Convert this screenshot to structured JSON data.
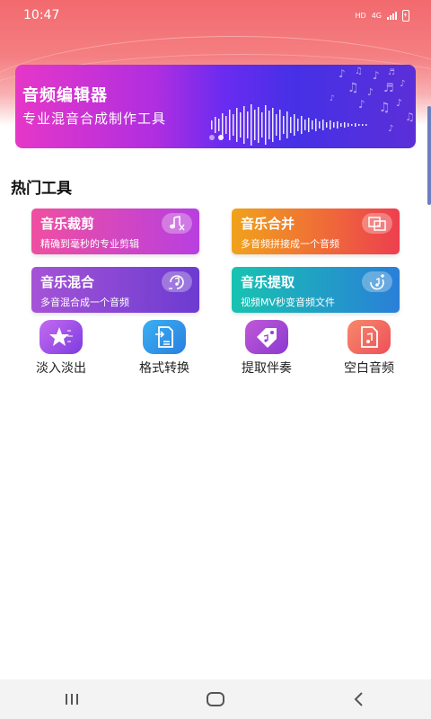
{
  "status_bar": {
    "time": "10:47",
    "hd": "HD",
    "network": "4G",
    "icons": [
      "hd-icon",
      "signal-icon",
      "battery-charging-icon"
    ]
  },
  "banner": {
    "title": "音频编辑器",
    "subtitle": "专业混音合成制作工具",
    "page_count": 2,
    "active_page": 2
  },
  "hot_tools": {
    "title": "热门工具",
    "cards": [
      {
        "title": "音乐裁剪",
        "desc": "精确到毫秒的专业剪辑",
        "icon": "music-scissors-icon"
      },
      {
        "title": "音乐合并",
        "desc": "多音频拼接成一个音频",
        "icon": "merge-icon"
      },
      {
        "title": "音乐混合",
        "desc": "多音混合成一个音频",
        "icon": "music-mix-icon"
      },
      {
        "title": "音乐提取",
        "desc": "视频MV秒变音频文件",
        "icon": "music-extract-icon"
      }
    ]
  },
  "quick_tools": [
    {
      "label": "淡入淡出",
      "icon": "star-fade-icon"
    },
    {
      "label": "格式转换",
      "icon": "file-convert-icon"
    },
    {
      "label": "提取伴奏",
      "icon": "tag-music-icon"
    },
    {
      "label": "空白音频",
      "icon": "blank-music-file-icon"
    }
  ],
  "nav": {
    "icons": [
      "recent-apps-icon",
      "home-icon",
      "back-icon"
    ]
  },
  "colors": {
    "header_red": "#f26a6e",
    "banner_pink": "#e637c8",
    "banner_blue": "#4630e6",
    "card_cut": "#ef4fa0",
    "card_merge": "#f0a21c",
    "card_mix": "#a553d6",
    "card_extract": "#17c3b1"
  }
}
